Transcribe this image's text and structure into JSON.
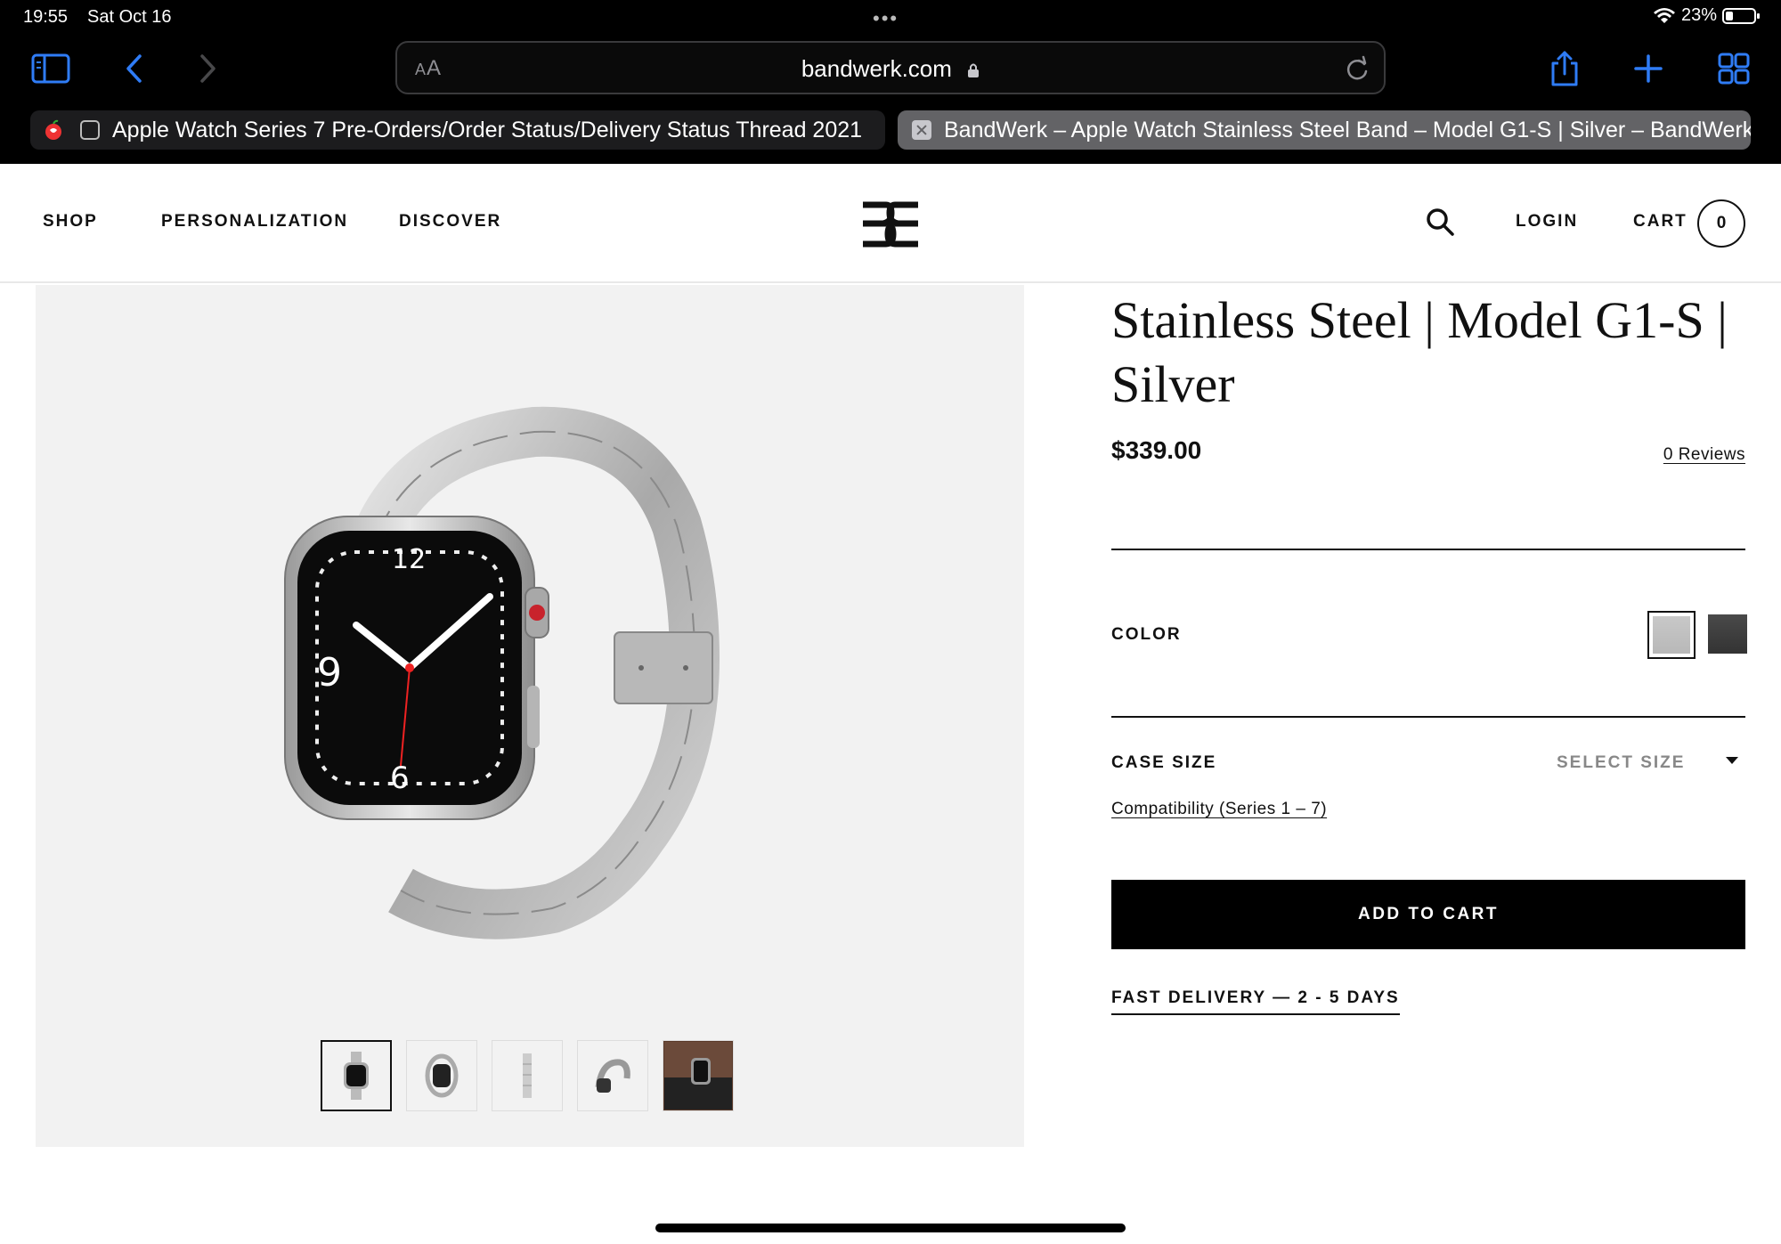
{
  "status_bar": {
    "time": "19:55",
    "date": "Sat Oct 16",
    "battery": "23%"
  },
  "toolbar": {
    "text_size_label": "AA",
    "url": "bandwerk.com",
    "icons": [
      "sidebar-icon",
      "back-icon",
      "forward-icon",
      "share-icon",
      "new-tab-icon",
      "tab-overview-icon"
    ]
  },
  "tabs": [
    {
      "title": "Apple Watch Series 7 Pre-Orders/Order Status/Delivery Status Thread 2021"
    },
    {
      "title": "BandWerk – Apple Watch Stainless Steel Band – Model G1-S | Silver – BandWerk"
    }
  ],
  "nav": {
    "shop": "SHOP",
    "personalization": "PERSONALIZATION",
    "discover": "DISCOVER",
    "login": "LOGIN",
    "cart": "CART",
    "cart_count": "0"
  },
  "product": {
    "title": "Stainless Steel | Model G1-S | Silver",
    "price": "$339.00",
    "reviews": "0 Reviews",
    "color_label": "COLOR",
    "colors": [
      {
        "name": "Silver",
        "hex": "#c0c0c0",
        "selected": true
      },
      {
        "name": "Black",
        "hex": "#3c3c3c",
        "selected": false
      }
    ],
    "case_size_label": "CASE SIZE",
    "case_size_value": "SELECT SIZE",
    "compatibility": "Compatibility (Series 1 – 7)",
    "add_to_cart": "ADD TO CART",
    "delivery": "FAST DELIVERY — 2 - 5 DAYS"
  },
  "colors": {
    "chrome_bg": "#000000",
    "accent_blue": "#2f7cf6",
    "button_bg": "#000000",
    "gallery_bg": "#f2f2f2"
  }
}
